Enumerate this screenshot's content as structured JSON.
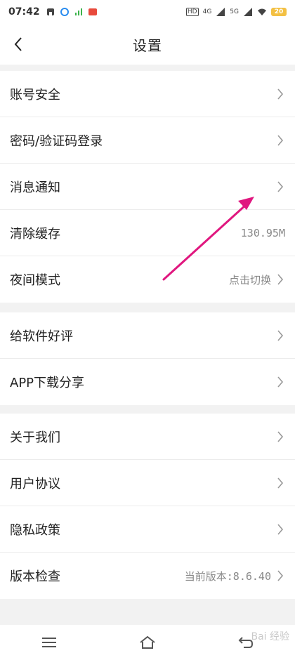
{
  "status_bar": {
    "time": "07:42",
    "hd_label": "HD",
    "net1": "4G",
    "net2": "5G",
    "battery": "20"
  },
  "header": {
    "title": "设置"
  },
  "groups": [
    {
      "items": [
        {
          "label": "账号安全"
        },
        {
          "label": "密码/验证码登录"
        },
        {
          "label": "消息通知"
        },
        {
          "label": "清除缓存",
          "value": "130.95M"
        },
        {
          "label": "夜间模式",
          "value": "点击切换"
        }
      ]
    },
    {
      "items": [
        {
          "label": "给软件好评"
        },
        {
          "label": "APP下载分享"
        }
      ]
    },
    {
      "items": [
        {
          "label": "关于我们"
        },
        {
          "label": "用户协议"
        },
        {
          "label": "隐私政策"
        },
        {
          "label": "版本检查",
          "value": "当前版本:8.6.40"
        }
      ]
    }
  ],
  "annotation_color": "#e0177f",
  "watermark": "Bai 经验"
}
